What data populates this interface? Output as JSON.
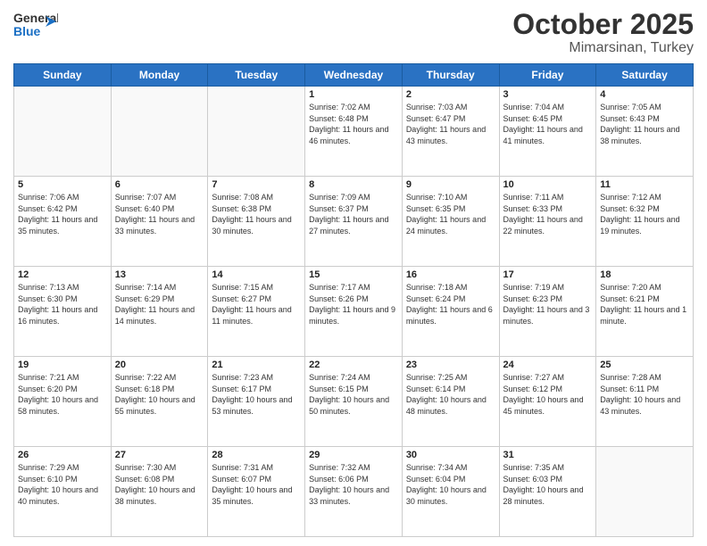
{
  "header": {
    "logo_general": "General",
    "logo_blue": "Blue",
    "month": "October 2025",
    "location": "Mimarsinan, Turkey"
  },
  "weekdays": [
    "Sunday",
    "Monday",
    "Tuesday",
    "Wednesday",
    "Thursday",
    "Friday",
    "Saturday"
  ],
  "weeks": [
    [
      {
        "day": "",
        "info": ""
      },
      {
        "day": "",
        "info": ""
      },
      {
        "day": "",
        "info": ""
      },
      {
        "day": "1",
        "info": "Sunrise: 7:02 AM\nSunset: 6:48 PM\nDaylight: 11 hours and 46 minutes."
      },
      {
        "day": "2",
        "info": "Sunrise: 7:03 AM\nSunset: 6:47 PM\nDaylight: 11 hours and 43 minutes."
      },
      {
        "day": "3",
        "info": "Sunrise: 7:04 AM\nSunset: 6:45 PM\nDaylight: 11 hours and 41 minutes."
      },
      {
        "day": "4",
        "info": "Sunrise: 7:05 AM\nSunset: 6:43 PM\nDaylight: 11 hours and 38 minutes."
      }
    ],
    [
      {
        "day": "5",
        "info": "Sunrise: 7:06 AM\nSunset: 6:42 PM\nDaylight: 11 hours and 35 minutes."
      },
      {
        "day": "6",
        "info": "Sunrise: 7:07 AM\nSunset: 6:40 PM\nDaylight: 11 hours and 33 minutes."
      },
      {
        "day": "7",
        "info": "Sunrise: 7:08 AM\nSunset: 6:38 PM\nDaylight: 11 hours and 30 minutes."
      },
      {
        "day": "8",
        "info": "Sunrise: 7:09 AM\nSunset: 6:37 PM\nDaylight: 11 hours and 27 minutes."
      },
      {
        "day": "9",
        "info": "Sunrise: 7:10 AM\nSunset: 6:35 PM\nDaylight: 11 hours and 24 minutes."
      },
      {
        "day": "10",
        "info": "Sunrise: 7:11 AM\nSunset: 6:33 PM\nDaylight: 11 hours and 22 minutes."
      },
      {
        "day": "11",
        "info": "Sunrise: 7:12 AM\nSunset: 6:32 PM\nDaylight: 11 hours and 19 minutes."
      }
    ],
    [
      {
        "day": "12",
        "info": "Sunrise: 7:13 AM\nSunset: 6:30 PM\nDaylight: 11 hours and 16 minutes."
      },
      {
        "day": "13",
        "info": "Sunrise: 7:14 AM\nSunset: 6:29 PM\nDaylight: 11 hours and 14 minutes."
      },
      {
        "day": "14",
        "info": "Sunrise: 7:15 AM\nSunset: 6:27 PM\nDaylight: 11 hours and 11 minutes."
      },
      {
        "day": "15",
        "info": "Sunrise: 7:17 AM\nSunset: 6:26 PM\nDaylight: 11 hours and 9 minutes."
      },
      {
        "day": "16",
        "info": "Sunrise: 7:18 AM\nSunset: 6:24 PM\nDaylight: 11 hours and 6 minutes."
      },
      {
        "day": "17",
        "info": "Sunrise: 7:19 AM\nSunset: 6:23 PM\nDaylight: 11 hours and 3 minutes."
      },
      {
        "day": "18",
        "info": "Sunrise: 7:20 AM\nSunset: 6:21 PM\nDaylight: 11 hours and 1 minute."
      }
    ],
    [
      {
        "day": "19",
        "info": "Sunrise: 7:21 AM\nSunset: 6:20 PM\nDaylight: 10 hours and 58 minutes."
      },
      {
        "day": "20",
        "info": "Sunrise: 7:22 AM\nSunset: 6:18 PM\nDaylight: 10 hours and 55 minutes."
      },
      {
        "day": "21",
        "info": "Sunrise: 7:23 AM\nSunset: 6:17 PM\nDaylight: 10 hours and 53 minutes."
      },
      {
        "day": "22",
        "info": "Sunrise: 7:24 AM\nSunset: 6:15 PM\nDaylight: 10 hours and 50 minutes."
      },
      {
        "day": "23",
        "info": "Sunrise: 7:25 AM\nSunset: 6:14 PM\nDaylight: 10 hours and 48 minutes."
      },
      {
        "day": "24",
        "info": "Sunrise: 7:27 AM\nSunset: 6:12 PM\nDaylight: 10 hours and 45 minutes."
      },
      {
        "day": "25",
        "info": "Sunrise: 7:28 AM\nSunset: 6:11 PM\nDaylight: 10 hours and 43 minutes."
      }
    ],
    [
      {
        "day": "26",
        "info": "Sunrise: 7:29 AM\nSunset: 6:10 PM\nDaylight: 10 hours and 40 minutes."
      },
      {
        "day": "27",
        "info": "Sunrise: 7:30 AM\nSunset: 6:08 PM\nDaylight: 10 hours and 38 minutes."
      },
      {
        "day": "28",
        "info": "Sunrise: 7:31 AM\nSunset: 6:07 PM\nDaylight: 10 hours and 35 minutes."
      },
      {
        "day": "29",
        "info": "Sunrise: 7:32 AM\nSunset: 6:06 PM\nDaylight: 10 hours and 33 minutes."
      },
      {
        "day": "30",
        "info": "Sunrise: 7:34 AM\nSunset: 6:04 PM\nDaylight: 10 hours and 30 minutes."
      },
      {
        "day": "31",
        "info": "Sunrise: 7:35 AM\nSunset: 6:03 PM\nDaylight: 10 hours and 28 minutes."
      },
      {
        "day": "",
        "info": ""
      }
    ]
  ]
}
